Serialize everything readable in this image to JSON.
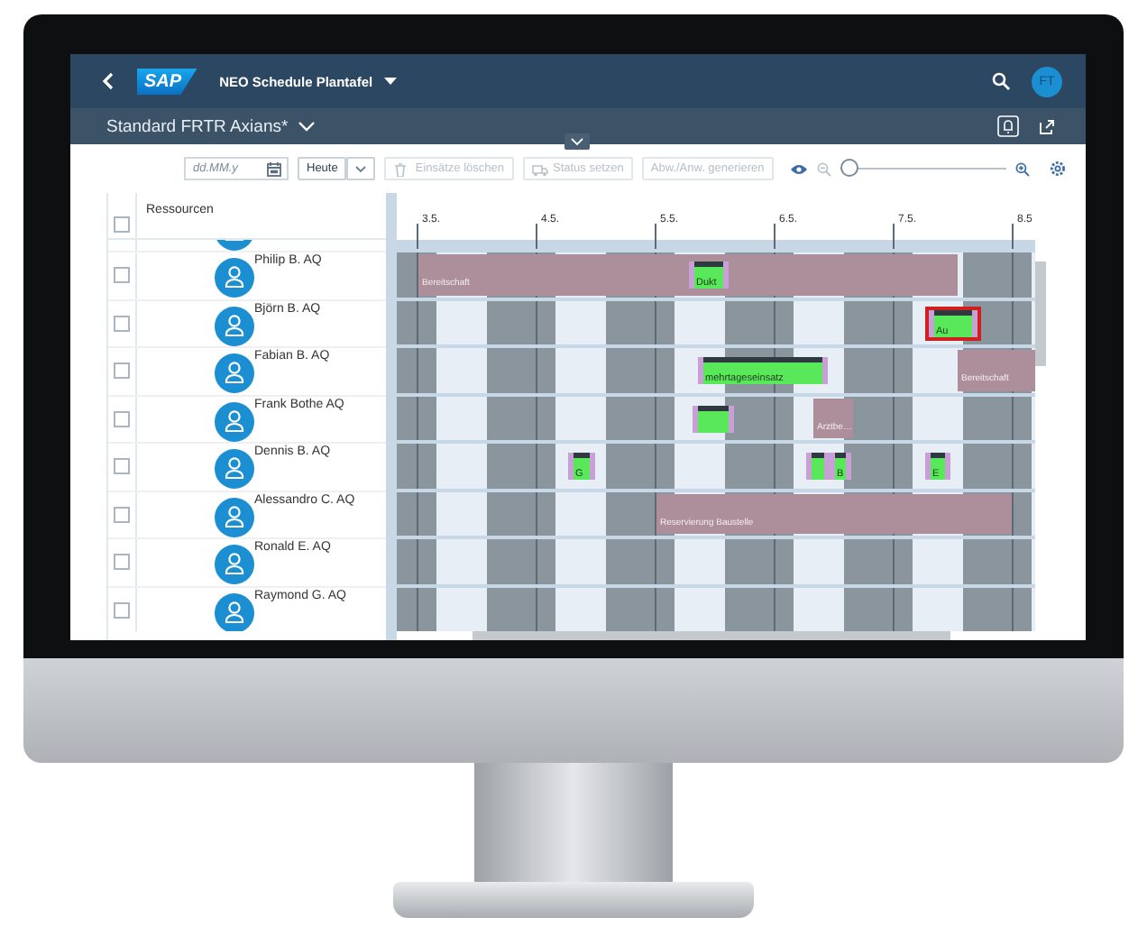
{
  "header": {
    "logo": "SAP",
    "title": "NEO Schedule Plantafel",
    "user_initials": "FT"
  },
  "variant": {
    "title": "Standard FRTR Axians*"
  },
  "toolbar": {
    "date_field": {
      "placeholder": "dd.MM.y"
    },
    "today_button": "Heute",
    "buttons": [
      {
        "label": "Einsätze löschen",
        "disabled": true
      },
      {
        "label": "Status setzen",
        "disabled": true
      },
      {
        "label": "Abw./Anw. generieren",
        "disabled": true
      }
    ],
    "zoom": {
      "level": 0.02
    }
  },
  "table": {
    "column": "Ressourcen",
    "header_checked": false,
    "dates": [
      "3.5.",
      "4.5.",
      "5.5.",
      "6.5.",
      "7.5.",
      "8.5"
    ],
    "rows": [
      {
        "bars": []
      },
      {
        "name": "Philip B. AQ",
        "checked": false,
        "bars": [
          {
            "kind": "absence",
            "label": "Bereitschaft"
          },
          {
            "kind": "assignment",
            "label": "Dukt",
            "flagged": false
          }
        ]
      },
      {
        "name": "Björn B. AQ",
        "checked": false,
        "bars": [
          {
            "kind": "assignment",
            "label": "Au",
            "flagged": true
          }
        ]
      },
      {
        "name": "Fabian B. AQ",
        "checked": false,
        "bars": [
          {
            "kind": "assignment",
            "label": "mehrtageseinsatz",
            "flagged": false
          },
          {
            "kind": "absence",
            "label": "Bereitschaft"
          }
        ]
      },
      {
        "name": "Frank Bothe AQ",
        "checked": false,
        "bars": [
          {
            "kind": "assignment",
            "flagged": false
          },
          {
            "kind": "absence",
            "label": "Arztbe…"
          }
        ]
      },
      {
        "name": "Dennis B. AQ",
        "checked": false,
        "bars": [
          {
            "kind": "assignment",
            "label": "G",
            "flagged": false
          },
          {
            "kind": "assignment",
            "flagged": false
          },
          {
            "kind": "assignment",
            "label": "B",
            "flagged": false
          },
          {
            "kind": "assignment",
            "label": "E",
            "flagged": false
          }
        ]
      },
      {
        "name": "Alessandro C. AQ",
        "checked": false,
        "bars": [
          {
            "kind": "absence",
            "label": "Reservierung Baustelle"
          }
        ]
      },
      {
        "name": "Ronald E. AQ",
        "checked": false,
        "bars": []
      },
      {
        "name": "Raymond G. AQ",
        "checked": false,
        "bars": []
      }
    ]
  }
}
